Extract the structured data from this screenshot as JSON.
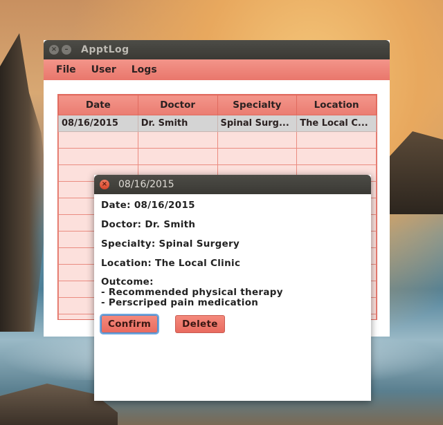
{
  "main_window": {
    "title": "ApptLog",
    "menu": [
      "File",
      "User",
      "Logs"
    ],
    "table": {
      "columns": [
        "Date",
        "Doctor",
        "Specialty",
        "Location"
      ],
      "rows": [
        [
          "08/16/2015",
          "Dr. Smith",
          "Spinal Surg...",
          "The Local C..."
        ]
      ]
    }
  },
  "dialog": {
    "title": "08/16/2015",
    "date_line": "Date: 08/16/2015",
    "doctor_line": "Doctor: Dr. Smith",
    "specialty_line": "Specialty: Spinal Surgery",
    "location_line": "Location: The Local Clinic",
    "outcome_label": "Outcome:",
    "outcome_items": [
      "- Recommended physical therapy",
      "- Perscriped pain medication"
    ],
    "confirm_label": "Confirm",
    "delete_label": "Delete"
  },
  "icons": {
    "close": "close-icon",
    "minimize": "minimize-icon"
  },
  "colors": {
    "accent": "#ea7c71",
    "table_bg": "#fce0dc",
    "selected_row": "#d4d4d4",
    "titlebar": "#3c3b37"
  }
}
